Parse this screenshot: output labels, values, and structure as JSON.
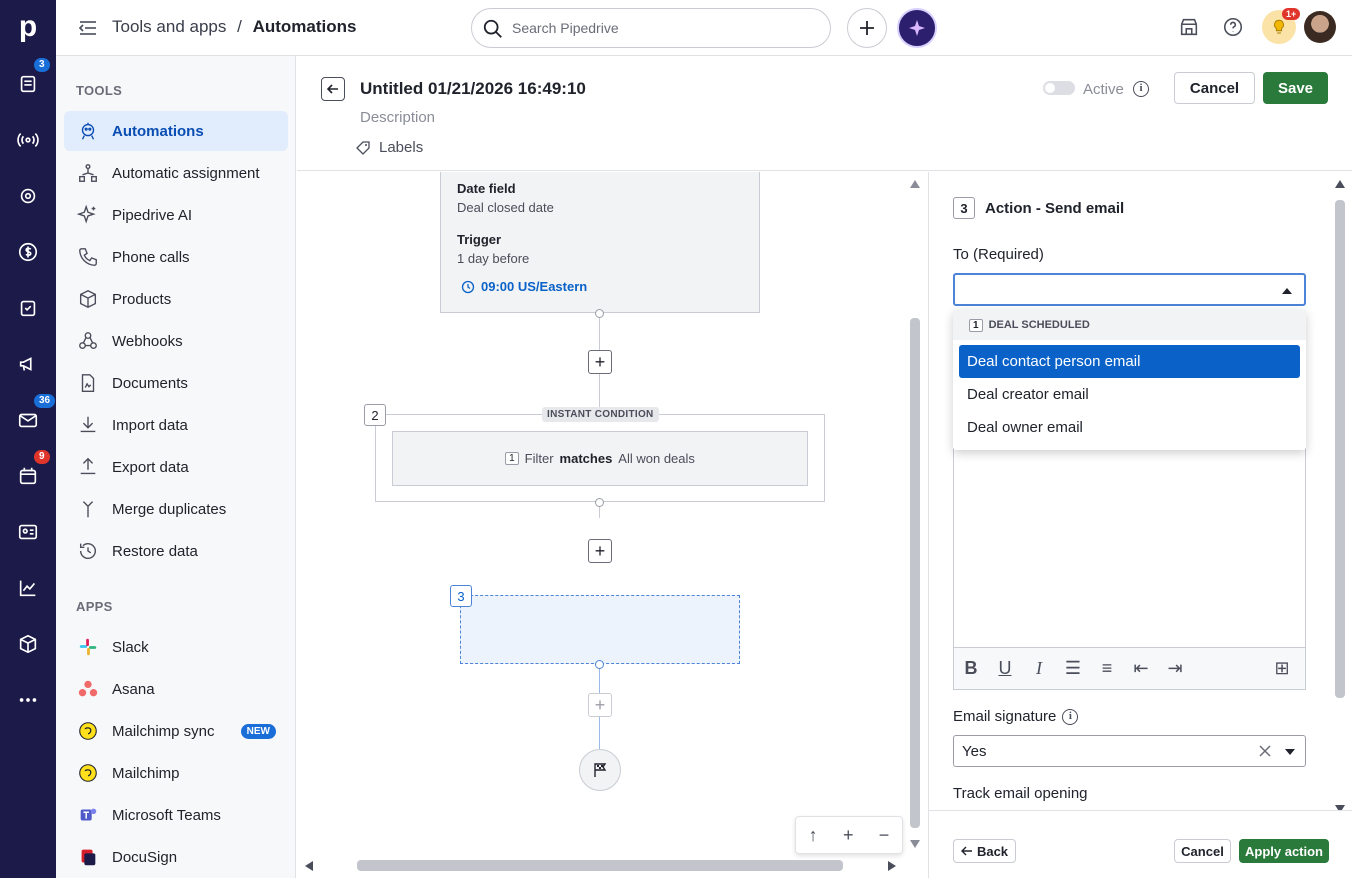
{
  "rail": {
    "badges": {
      "leads": "3",
      "mail": "36",
      "calendar": "9"
    }
  },
  "topbar": {
    "breadcrumb_parent": "Tools and apps",
    "breadcrumb_sep": "/",
    "breadcrumb_current": "Automations",
    "search_placeholder": "Search Pipedrive",
    "notif_badge": "1+"
  },
  "sidebar": {
    "tools_heading": "TOOLS",
    "tools": [
      {
        "label": "Automations",
        "icon": "automations-icon",
        "active": true
      },
      {
        "label": "Automatic assignment",
        "icon": "assignment-icon"
      },
      {
        "label": "Pipedrive AI",
        "icon": "sparkle-icon"
      },
      {
        "label": "Phone calls",
        "icon": "phone-icon"
      },
      {
        "label": "Products",
        "icon": "box-icon"
      },
      {
        "label": "Webhooks",
        "icon": "webhook-icon"
      },
      {
        "label": "Documents",
        "icon": "document-icon"
      },
      {
        "label": "Import data",
        "icon": "import-icon"
      },
      {
        "label": "Export data",
        "icon": "export-icon"
      },
      {
        "label": "Merge duplicates",
        "icon": "merge-icon"
      },
      {
        "label": "Restore data",
        "icon": "restore-icon"
      }
    ],
    "apps_heading": "APPS",
    "apps": [
      {
        "label": "Slack",
        "icon": "slack-icon"
      },
      {
        "label": "Asana",
        "icon": "asana-icon"
      },
      {
        "label": "Mailchimp sync",
        "icon": "mailchimp-icon",
        "badge": "NEW"
      },
      {
        "label": "Mailchimp",
        "icon": "mailchimp-icon"
      },
      {
        "label": "Microsoft Teams",
        "icon": "teams-icon"
      },
      {
        "label": "DocuSign",
        "icon": "docusign-icon"
      }
    ]
  },
  "header": {
    "title": "Untitled 01/21/2026 16:49:10",
    "description": "Description",
    "labels": "Labels",
    "active_label": "Active",
    "cancel": "Cancel",
    "save": "Save"
  },
  "canvas": {
    "trigger": {
      "date_field_label": "Date field",
      "date_field_value": "Deal closed date",
      "trigger_label": "Trigger",
      "trigger_value": "1 day before",
      "time": "09:00 US/Eastern"
    },
    "condition": {
      "step": "2",
      "tag": "INSTANT CONDITION",
      "filter_num": "1",
      "filter_word": "Filter",
      "matches": "matches",
      "filter_value": "All won deals"
    },
    "action_step": "3"
  },
  "panel": {
    "step": "3",
    "title": "Action - Send email",
    "to_label": "To (Required)",
    "to_value": "",
    "dropdown": {
      "group_num": "1",
      "group_label": "DEAL SCHEDULED",
      "options": [
        "Deal contact person email",
        "Deal creator email",
        "Deal owner email"
      ],
      "selected_index": 0
    },
    "signature_label": "Email signature",
    "signature_value": "Yes",
    "track_label": "Track email opening",
    "back": "Back",
    "cancel": "Cancel",
    "apply": "Apply action"
  },
  "colors": {
    "rail": "#1b1a48",
    "accent_blue": "#0a62c8",
    "save_green": "#2a7a3b"
  }
}
